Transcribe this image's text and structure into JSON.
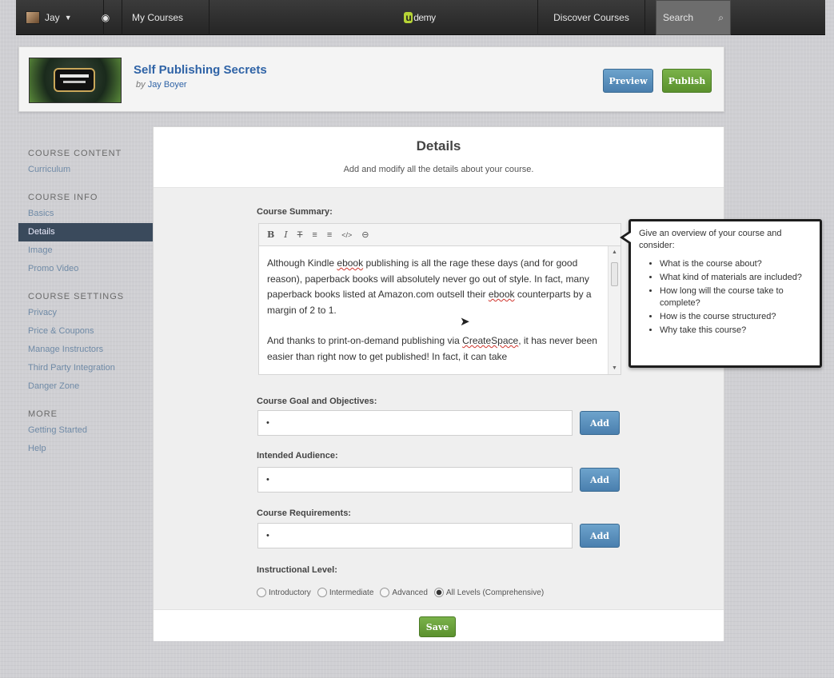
{
  "topbar": {
    "user_label": "Jay",
    "my_courses_label": "My Courses",
    "logo_u": "u",
    "logo_rest": "demy",
    "discover_label": "Discover Courses",
    "search_label": "Search"
  },
  "course": {
    "title": "Self Publishing Secrets",
    "author_prefix": "by",
    "author_name": "Jay Boyer",
    "preview_label": "Preview",
    "publish_label": "Publish"
  },
  "sidebar": {
    "groups": [
      {
        "heading": "COURSE CONTENT",
        "items": [
          "Curriculum"
        ]
      },
      {
        "heading": "COURSE INFO",
        "items": [
          "Basics",
          "Details",
          "Image",
          "Promo Video"
        ]
      },
      {
        "heading": "COURSE SETTINGS",
        "items": [
          "Privacy",
          "Price & Coupons",
          "Manage Instructors",
          "Third Party Integration",
          "Danger Zone"
        ]
      },
      {
        "heading": "MORE",
        "items": [
          "Getting Started",
          "Help"
        ]
      }
    ],
    "active_item": "Details"
  },
  "main": {
    "title": "Details",
    "subtitle": "Add and modify all the details about your course.",
    "summary_label": "Course Summary:",
    "toolbar": {
      "bold": "B",
      "italic": "I",
      "strike": "T",
      "ul": "≡",
      "ol": "≡",
      "code": "</>",
      "link": "⊖"
    },
    "summary_p1_a": "Although Kindle ",
    "summary_p1_spell1": "ebook",
    "summary_p1_b": " publishing is all the rage these days (and for good reason), paperback books will absolutely never go out of style.  In fact, many paperback books listed at Amazon.com outsell their ",
    "summary_p1_spell2": "ebook",
    "summary_p1_c": " counterparts by a margin of 2 to 1.",
    "summary_p2_a": "And thanks to print-on-demand publishing via ",
    "summary_p2_spell": "CreateSpace",
    "summary_p2_b": ", it has never been easier than right now to get published!  In fact, it can take",
    "goal_label": "Course Goal and Objectives:",
    "goal_value": "•",
    "audience_label": "Intended Audience:",
    "audience_value": "•",
    "req_label": "Course Requirements:",
    "req_value": "•",
    "add_label": "Add",
    "level_label": "Instructional Level:",
    "levels": [
      "Introductory",
      "Intermediate",
      "Advanced",
      "All Levels (Comprehensive)"
    ],
    "level_selected": "All Levels (Comprehensive)",
    "save_label": "Save"
  },
  "tooltip": {
    "intro": "Give an overview of your course and consider:",
    "bullets": [
      "What is the course about?",
      "What kind of materials are included?",
      "How long will the course take to complete?",
      "How is the course structured?",
      "Why take this course?"
    ]
  },
  "colors": {
    "accent_blue": "#4a7fae",
    "accent_green": "#5b912e",
    "link": "#2f63a6",
    "topbar": "#2b2b2b"
  }
}
